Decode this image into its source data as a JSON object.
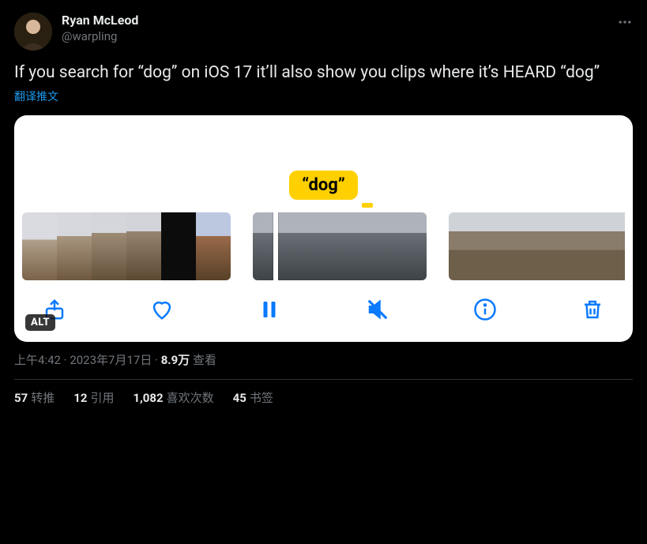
{
  "author": {
    "display_name": "Ryan McLeod",
    "handle": "@warpling"
  },
  "tweet_text": "If you search for “dog” on iOS 17 it’ll also show you clips where it’s HEARD “dog”",
  "translate_label": "翻译推文",
  "media": {
    "bubble_label": "“dog”",
    "alt_badge": "ALT"
  },
  "meta": {
    "time": "上午4:42",
    "sep1": " · ",
    "date": "2023年7月17日",
    "sep2": " · ",
    "views_count": "8.9万",
    "views_label": " 查看"
  },
  "stats": {
    "retweets_count": "57",
    "retweets_label": "转推",
    "quotes_count": "12",
    "quotes_label": "引用",
    "likes_count": "1,082",
    "likes_label": "喜欢次数",
    "bookmarks_count": "45",
    "bookmarks_label": "书签"
  }
}
